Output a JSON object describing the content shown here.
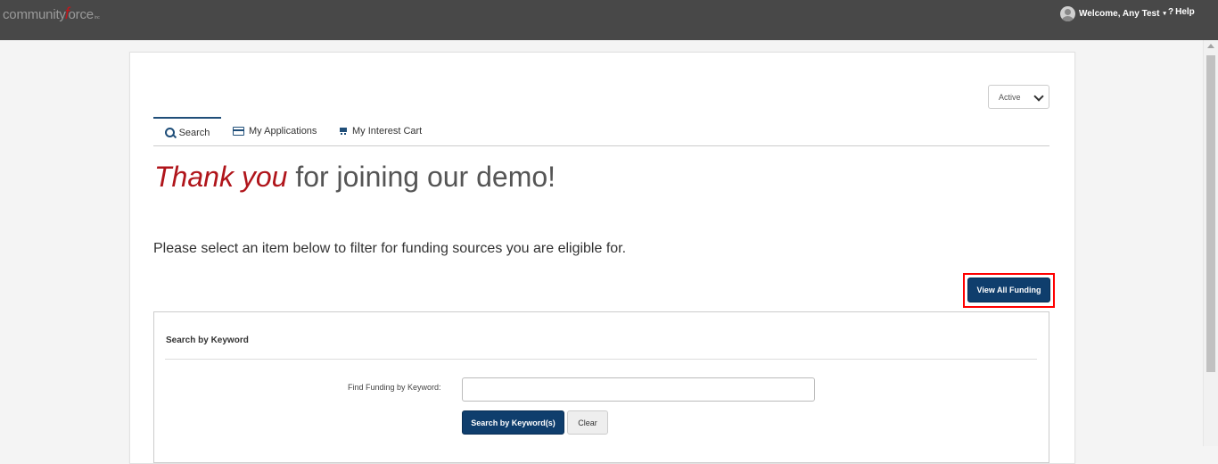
{
  "header": {
    "logo_text_before": "community",
    "logo_slash": "f",
    "logo_text_after": "orce",
    "logo_tm": "inc",
    "welcome": "Welcome, Any Test",
    "help": "Help"
  },
  "filter": {
    "status_selected": "Active"
  },
  "tabs": [
    {
      "label": "Search",
      "icon": "search-icon",
      "active": true
    },
    {
      "label": "My Applications",
      "icon": "credit-card-icon",
      "active": false
    },
    {
      "label": "My Interest Cart",
      "icon": "cart-icon",
      "active": false
    }
  ],
  "main": {
    "headline_accent": "Thank you",
    "headline_rest": " for joining our demo!",
    "instruction": "Please select an item below to filter for funding sources you are eligible for.",
    "view_all_label": "View All Funding"
  },
  "keyword_panel": {
    "title": "Search by Keyword",
    "field_label": "Find Funding by Keyword:",
    "field_value": "",
    "search_label": "Search by Keyword(s)",
    "clear_label": "Clear"
  },
  "colors": {
    "topbar": "#484848",
    "brand_red": "#b0151b",
    "primary_button": "#0f3e6d",
    "highlight_border": "#ff0000"
  }
}
